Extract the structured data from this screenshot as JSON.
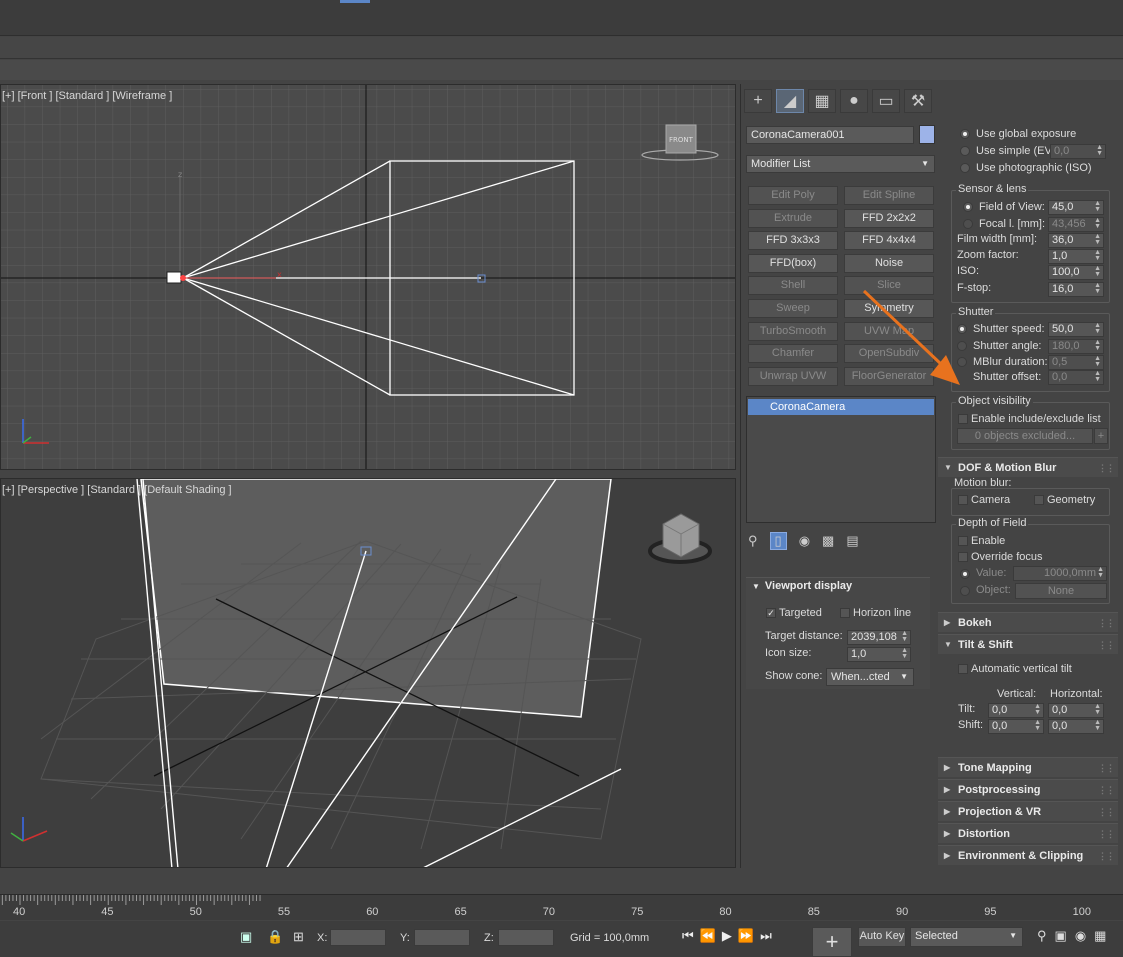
{
  "colors": {
    "accent": "#5b86c7",
    "highlight": "#e8721e",
    "selection": "#5b86c7"
  },
  "viewport_front": {
    "label": "[+] [Front ] [Standard ] [Wireframe ]",
    "viewcube_label": "FRONT",
    "axis_x": "x",
    "axis_z": "z"
  },
  "viewport_persp": {
    "label": "[+] [Perspective ] [Standard ] [Default Shading ]"
  },
  "cmd_tabs": [
    "create",
    "modify",
    "hierarchy",
    "motion",
    "display",
    "utilities"
  ],
  "object_name": "CoronaCamera001",
  "modifier_list": "Modifier List",
  "modifier_buttons": [
    {
      "label": "Edit Poly",
      "enabled": false
    },
    {
      "label": "Edit Spline",
      "enabled": false
    },
    {
      "label": "Extrude",
      "enabled": false
    },
    {
      "label": "FFD 2x2x2",
      "enabled": true
    },
    {
      "label": "FFD 3x3x3",
      "enabled": true
    },
    {
      "label": "FFD 4x4x4",
      "enabled": true
    },
    {
      "label": "FFD(box)",
      "enabled": true
    },
    {
      "label": "Noise",
      "enabled": true
    },
    {
      "label": "Shell",
      "enabled": false
    },
    {
      "label": "Slice",
      "enabled": false
    },
    {
      "label": "Sweep",
      "enabled": false
    },
    {
      "label": "Symmetry",
      "enabled": true
    },
    {
      "label": "TurboSmooth",
      "enabled": false
    },
    {
      "label": "UVW Map",
      "enabled": false
    },
    {
      "label": "Chamfer",
      "enabled": false
    },
    {
      "label": "OpenSubdiv",
      "enabled": false
    },
    {
      "label": "Unwrap UVW",
      "enabled": false
    },
    {
      "label": "FloorGenerator",
      "enabled": false
    }
  ],
  "stack_item": "CoronaCamera",
  "viewport_display": {
    "title": "Viewport display",
    "targeted": "Targeted",
    "horizon": "Horizon line",
    "target_distance_label": "Target distance:",
    "target_distance": "2039,108",
    "icon_size_label": "Icon size:",
    "icon_size": "1,0",
    "show_cone_label": "Show cone:",
    "show_cone": "When...cted"
  },
  "exposure": {
    "use_global": "Use global exposure",
    "use_simple": "Use simple (EV)",
    "simple_value": "0,0",
    "use_photographic": "Use photographic (ISO)"
  },
  "sensor": {
    "title": "Sensor & lens",
    "fov_label": "Field of View:",
    "fov": "45,0",
    "focal_label": "Focal l. [mm]:",
    "focal": "43,456",
    "film_label": "Film width [mm]:",
    "film": "36,0",
    "zoom_label": "Zoom factor:",
    "zoom": "1,0",
    "iso_label": "ISO:",
    "iso": "100,0",
    "fstop_label": "F-stop:",
    "fstop": "16,0"
  },
  "shutter": {
    "title": "Shutter",
    "speed_label": "Shutter speed:",
    "speed": "50,0",
    "angle_label": "Shutter angle:",
    "angle": "180,0",
    "mblur_label": "MBlur duration:",
    "mblur": "0,5",
    "offset_label": "Shutter offset:",
    "offset": "0,0"
  },
  "object_visibility": {
    "title": "Object visibility",
    "enable": "Enable include/exclude list",
    "excluded": "0 objects excluded...",
    "plus": "+"
  },
  "dof_motion": {
    "title": "DOF & Motion Blur",
    "motion_blur_label": "Motion blur:",
    "camera": "Camera",
    "geometry": "Geometry",
    "dof_title": "Depth of Field",
    "enable": "Enable",
    "override": "Override focus",
    "value_label": "Value:",
    "value": "1000,0mm",
    "object_label": "Object:",
    "object": "None"
  },
  "bokeh": "Bokeh",
  "tilt_shift": {
    "title": "Tilt & Shift",
    "auto": "Automatic vertical tilt",
    "vertical": "Vertical:",
    "horizontal": "Horizontal:",
    "tilt_label": "Tilt:",
    "shift_label": "Shift:",
    "tilt_v": "0,0",
    "tilt_h": "0,0",
    "shift_v": "0,0",
    "shift_h": "0,0"
  },
  "rollouts": [
    "Tone Mapping",
    "Postprocessing",
    "Projection & VR",
    "Distortion",
    "Environment & Clipping"
  ],
  "timeline_ticks": [
    "40",
    "45",
    "50",
    "55",
    "60",
    "65",
    "70",
    "75",
    "80",
    "85",
    "90",
    "95",
    "100"
  ],
  "status": {
    "x_label": "X:",
    "y_label": "Y:",
    "z_label": "Z:",
    "grid": "Grid = 100,0mm",
    "auto_key": "Auto Key",
    "selected": "Selected"
  }
}
